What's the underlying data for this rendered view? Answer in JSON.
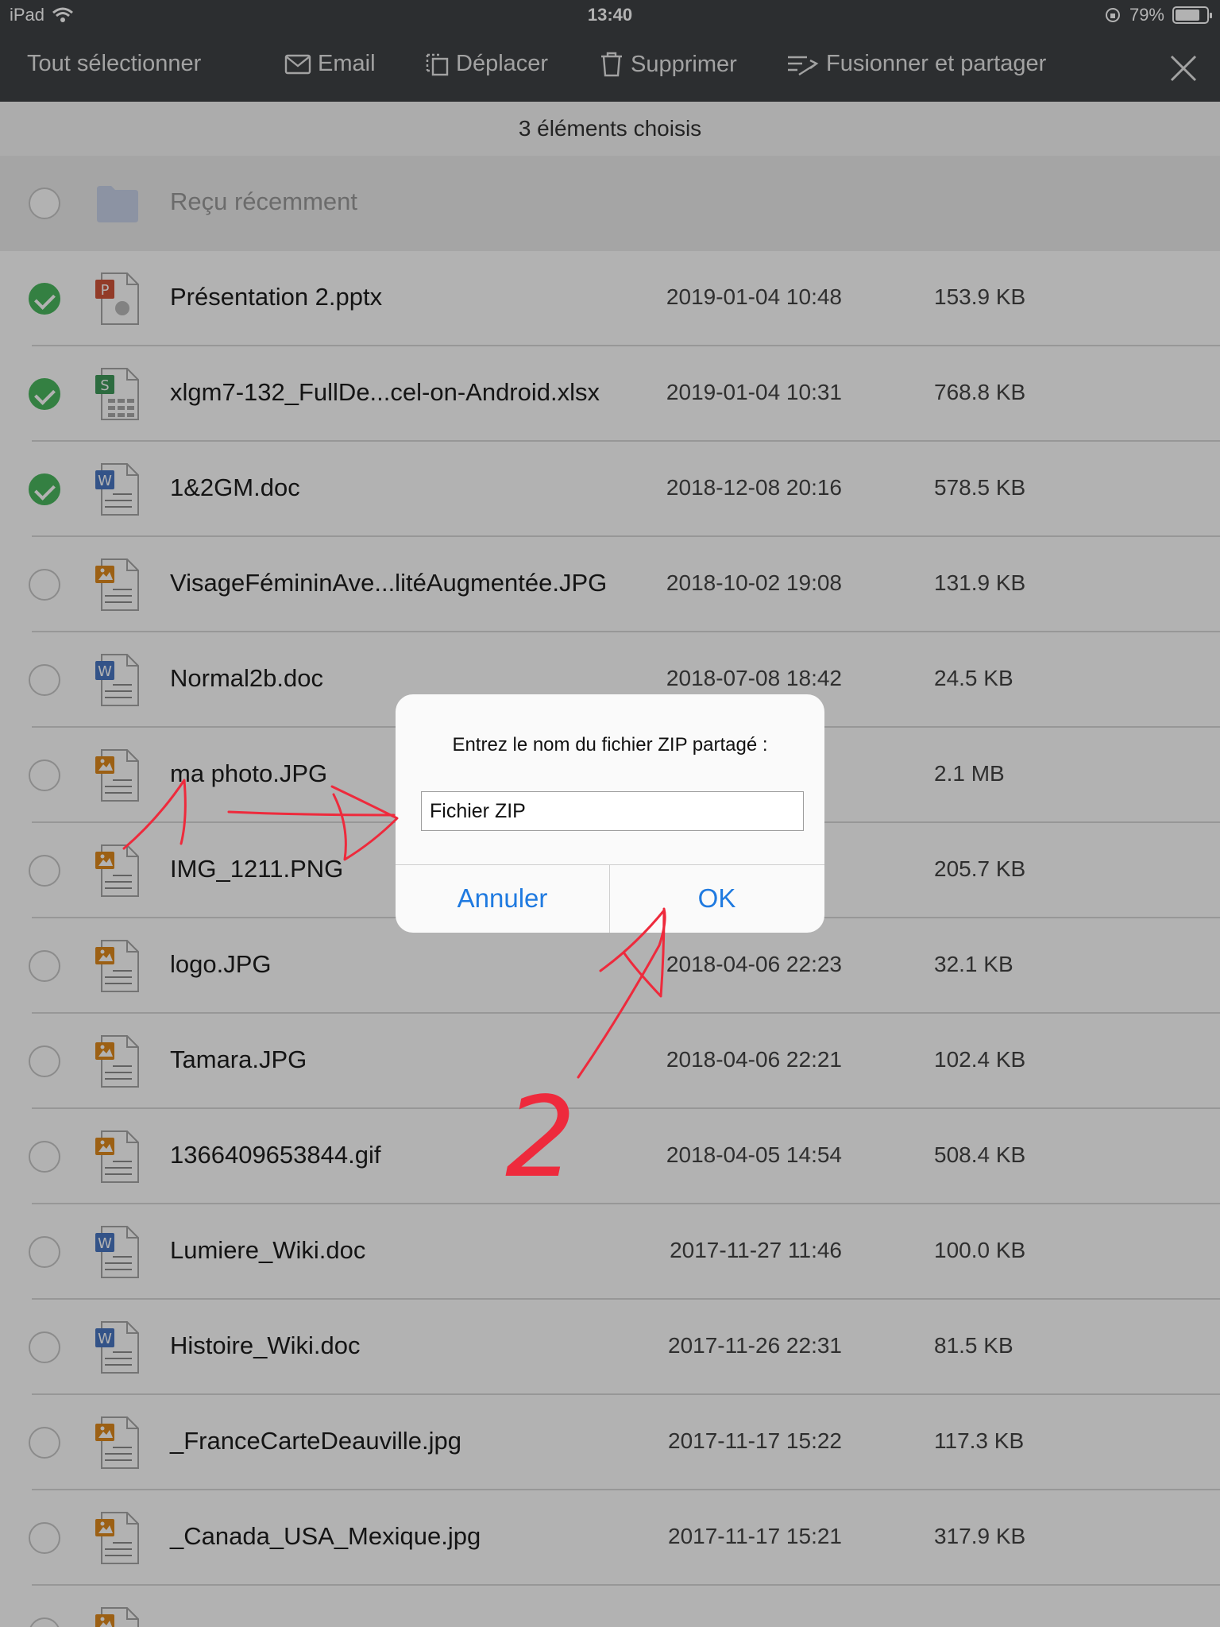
{
  "status_bar": {
    "device": "iPad",
    "time": "13:40",
    "battery": "79%",
    "battery_level": 0.79
  },
  "toolbar": {
    "select_all": "Tout sélectionner",
    "email": "Email",
    "move": "Déplacer",
    "delete": "Supprimer",
    "merge_share": "Fusionner et partager"
  },
  "subheader": "3 éléments choisis",
  "folder": {
    "label": "Reçu récemment"
  },
  "files": [
    {
      "name": "Présentation 2.pptx",
      "date": "2019-01-04 10:48",
      "size": "153.9 KB",
      "type": "pptx",
      "checked": true
    },
    {
      "name": "xlgm7-132_FullDe...cel-on-Android.xlsx",
      "date": "2019-01-04 10:31",
      "size": "768.8 KB",
      "type": "xlsx",
      "checked": true
    },
    {
      "name": "1&2GM.doc",
      "date": "2018-12-08 20:16",
      "size": "578.5 KB",
      "type": "doc",
      "checked": true
    },
    {
      "name": "VisageFémininAve...litéAugmentée.JPG",
      "date": "2018-10-02 19:08",
      "size": "131.9 KB",
      "type": "img",
      "checked": false
    },
    {
      "name": "Normal2b.doc",
      "date": "2018-07-08 18:42",
      "size": "24.5 KB",
      "type": "doc",
      "checked": false
    },
    {
      "name": "ma photo.JPG",
      "date": "",
      "size": "2.1 MB",
      "type": "img",
      "checked": false
    },
    {
      "name": "IMG_1211.PNG",
      "date": "",
      "size": "205.7 KB",
      "type": "img",
      "checked": false
    },
    {
      "name": "logo.JPG",
      "date": "2018-04-06 22:23",
      "size": "32.1 KB",
      "type": "img",
      "checked": false
    },
    {
      "name": "Tamara.JPG",
      "date": "2018-04-06 22:21",
      "size": "102.4 KB",
      "type": "img",
      "checked": false
    },
    {
      "name": "1366409653844.gif",
      "date": "2018-04-05 14:54",
      "size": "508.4 KB",
      "type": "img",
      "checked": false
    },
    {
      "name": "Lumiere_Wiki.doc",
      "date": "2017-11-27 11:46",
      "size": "100.0 KB",
      "type": "doc",
      "checked": false
    },
    {
      "name": "Histoire_Wiki.doc",
      "date": "2017-11-26 22:31",
      "size": "81.5 KB",
      "type": "doc",
      "checked": false
    },
    {
      "name": "_FranceCarteDeauville.jpg",
      "date": "2017-11-17 15:22",
      "size": "117.3 KB",
      "type": "img",
      "checked": false
    },
    {
      "name": "_Canada_USA_Mexique.jpg",
      "date": "2017-11-17 15:21",
      "size": "317.9 KB",
      "type": "img",
      "checked": false
    },
    {
      "name": "",
      "date": "",
      "size": "",
      "type": "img",
      "checked": false
    }
  ],
  "dialog": {
    "title": "Entrez le nom du fichier ZIP partagé :",
    "input_value": "Fichier ZIP",
    "cancel": "Annuler",
    "ok": "OK"
  },
  "annotation": {
    "number": "2",
    "color": "#ee2a3c"
  },
  "colors": {
    "toolbar_bg": "#3f4246",
    "check_green": "#4bb85f",
    "ios_blue": "#1f7ae0",
    "ppt_red": "#d2553a",
    "xls_green": "#3f9a5b",
    "doc_blue": "#4a78c3",
    "img_orange": "#e08a1e"
  }
}
